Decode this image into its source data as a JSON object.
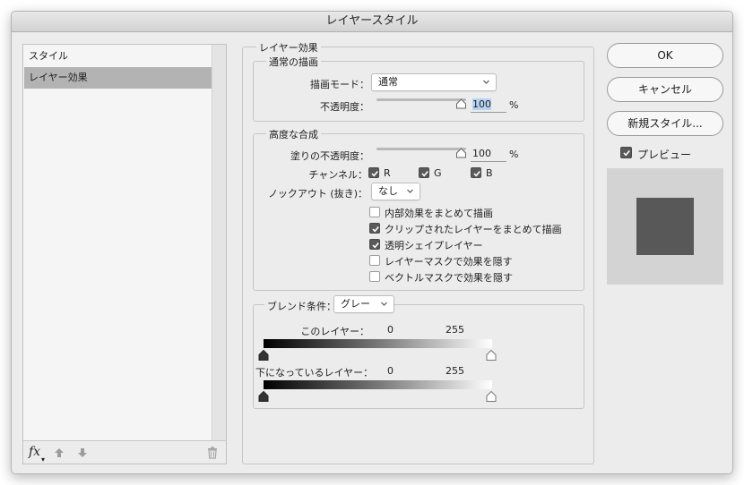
{
  "window": {
    "title": "レイヤースタイル"
  },
  "sidebar": {
    "items": [
      {
        "label": "スタイル",
        "selected": false
      },
      {
        "label": "レイヤー効果",
        "selected": true
      }
    ],
    "footer": {
      "fx_label": "fx",
      "fx_caret": "▾"
    }
  },
  "layer_effects": {
    "title": "レイヤー効果",
    "normal_blend": {
      "title": "通常の描画",
      "blend_mode_label": "描画モード：",
      "blend_mode_value": "通常",
      "opacity_label": "不透明度：",
      "opacity_value": "100",
      "opacity_unit": "%",
      "opacity_level": 1.0
    },
    "advanced_blend": {
      "title": "高度な合成",
      "fill_opacity_label": "塗りの不透明度：",
      "fill_opacity_value": "100",
      "fill_opacity_unit": "%",
      "fill_opacity_level": 1.0,
      "channels_label": "チャンネル：",
      "channels": [
        {
          "label": "R",
          "checked": true
        },
        {
          "label": "G",
          "checked": true
        },
        {
          "label": "B",
          "checked": true
        }
      ],
      "knockout_label": "ノックアウト (抜き)：",
      "knockout_value": "なし",
      "options": [
        {
          "label": "内部効果をまとめて描画",
          "checked": false
        },
        {
          "label": "クリップされたレイヤーをまとめて描画",
          "checked": true
        },
        {
          "label": "透明シェイプレイヤー",
          "checked": true
        },
        {
          "label": "レイヤーマスクで効果を隠す",
          "checked": false
        },
        {
          "label": "ベクトルマスクで効果を隠す",
          "checked": false
        }
      ]
    },
    "blend_if": {
      "label": "ブレンド条件：",
      "value": "グレー",
      "this_layer_label": "このレイヤー：",
      "this_layer_min": "0",
      "this_layer_max": "255",
      "underlying_label": "下になっているレイヤー：",
      "underlying_min": "0",
      "underlying_max": "255"
    }
  },
  "buttons": {
    "ok": "OK",
    "cancel": "キャンセル",
    "new_style": "新規スタイル..."
  },
  "preview": {
    "label": "プレビュー",
    "checked": true,
    "swatch_color": "#585858"
  },
  "colors": {
    "window_bg": "#ececec",
    "selection": "#b3b3b3",
    "checkbox_on": "#595959"
  }
}
